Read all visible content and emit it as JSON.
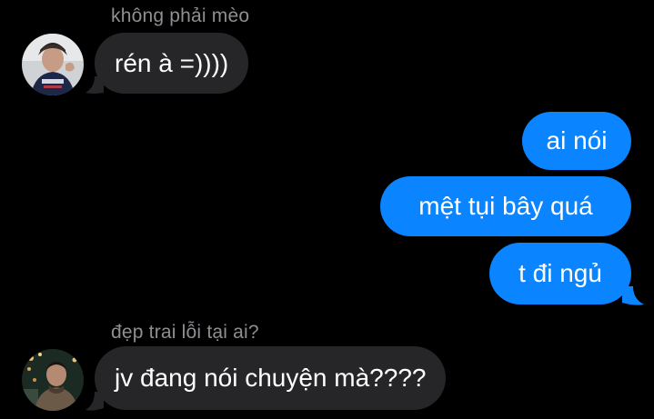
{
  "theme": {
    "background": "#000000",
    "incoming_bubble": "#262629",
    "outgoing_bubble": "#0b84ff",
    "sender_name_color": "#8e8e93"
  },
  "messages": [
    {
      "direction": "incoming",
      "sender": "không phải mèo",
      "avatar": "avatar-photo",
      "text": "rén à =))))"
    },
    {
      "direction": "outgoing",
      "text": "ai nói"
    },
    {
      "direction": "outgoing",
      "text": "mệt tụi bây quá"
    },
    {
      "direction": "outgoing",
      "text": "t đi ngủ"
    },
    {
      "direction": "incoming",
      "sender": "đẹp trai lỗi tại ai?",
      "avatar": "avatar-photo",
      "text": "jv đang nói chuyện mà????"
    }
  ]
}
